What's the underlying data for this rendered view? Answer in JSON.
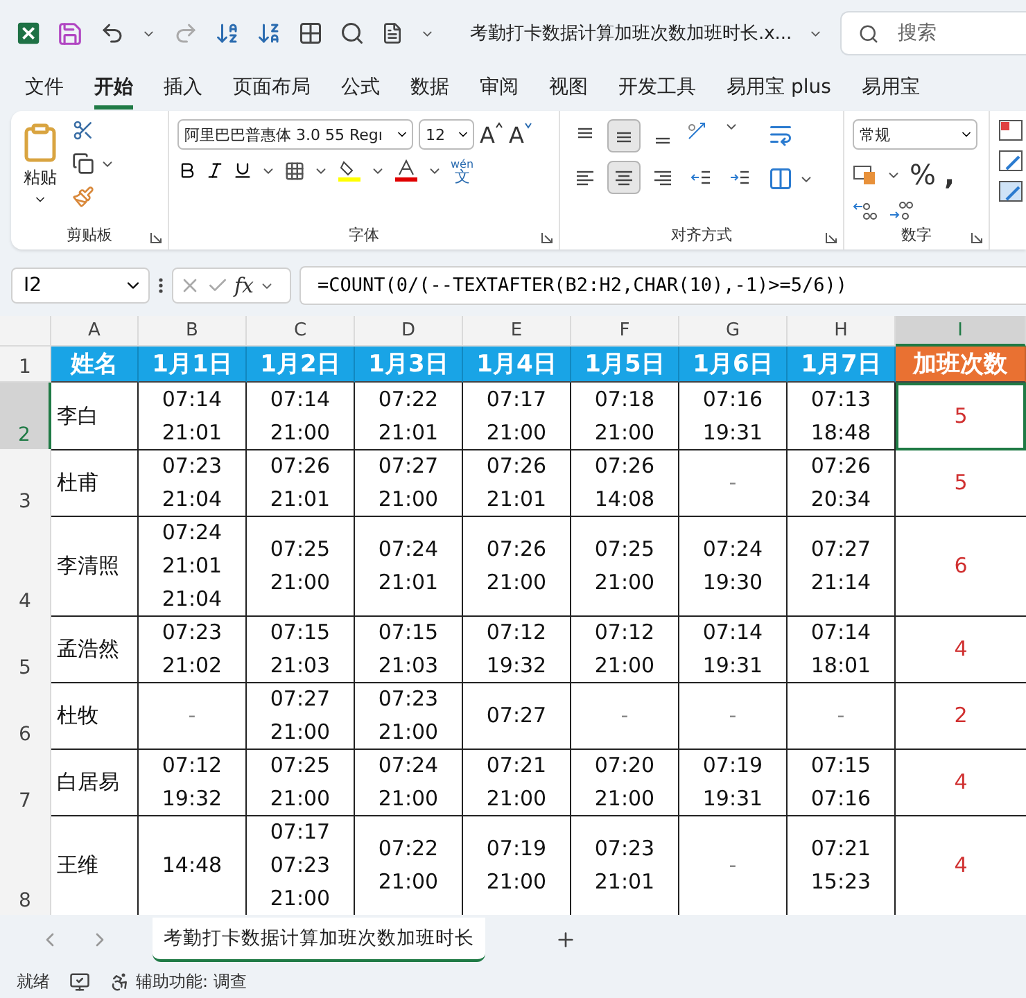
{
  "title_bar": {
    "document_title": "考勤打卡数据计算加班次数加班时长.x...",
    "search": {
      "placeholder": "搜索"
    }
  },
  "menu_tabs": [
    {
      "label": "文件",
      "selected": false
    },
    {
      "label": "开始",
      "selected": true
    },
    {
      "label": "插入",
      "selected": false
    },
    {
      "label": "页面布局",
      "selected": false
    },
    {
      "label": "公式",
      "selected": false
    },
    {
      "label": "数据",
      "selected": false
    },
    {
      "label": "审阅",
      "selected": false
    },
    {
      "label": "视图",
      "selected": false
    },
    {
      "label": "开发工具",
      "selected": false
    },
    {
      "label": "易用宝 plus",
      "selected": false
    },
    {
      "label": "易用宝",
      "selected": false
    }
  ],
  "ribbon": {
    "clipboard": {
      "paste_label": "粘贴",
      "group_label": "剪贴板"
    },
    "font": {
      "font_name": "阿里巴巴普惠体 3.0 55 Regı",
      "font_size": "12",
      "grow_label": "A",
      "shrink_label": "A",
      "phonetic_top": "wén",
      "phonetic_bottom": "文",
      "group_label": "字体"
    },
    "alignment": {
      "buttons": [
        {
          "kind": "top",
          "pressed": false
        },
        {
          "kind": "middle",
          "pressed": true
        },
        {
          "kind": "bottom",
          "pressed": false
        },
        {
          "kind": "left",
          "pressed": false
        },
        {
          "kind": "center",
          "pressed": true
        },
        {
          "kind": "right",
          "pressed": false
        },
        {
          "kind": "outdent",
          "pressed": false
        },
        {
          "kind": "indent",
          "pressed": false
        }
      ],
      "group_label": "对齐方式"
    },
    "number": {
      "format": "常规",
      "percent": "%",
      "comma": ",",
      "group_label": "数字"
    }
  },
  "formula_bar": {
    "name_box": "I2",
    "insert_function": "fx",
    "formula": "=COUNT(0/(--TEXTAFTER(B2:H2,CHAR(10),-1)>=5/6))"
  },
  "columns": [
    {
      "label": "A",
      "selected": false
    },
    {
      "label": "B",
      "selected": false
    },
    {
      "label": "C",
      "selected": false
    },
    {
      "label": "D",
      "selected": false
    },
    {
      "label": "E",
      "selected": false
    },
    {
      "label": "F",
      "selected": false
    },
    {
      "label": "G",
      "selected": false
    },
    {
      "label": "H",
      "selected": false
    },
    {
      "label": "I",
      "selected": true
    }
  ],
  "header_row": {
    "number": "1",
    "selected": false,
    "name": "姓名",
    "dates": [
      "1月1日",
      "1月2日",
      "1月3日",
      "1月4日",
      "1月5日",
      "1月6日",
      "1月7日"
    ],
    "count": "加班次数"
  },
  "rows": [
    {
      "number": "2",
      "selected": true,
      "name": "李白",
      "days": [
        [
          "07:14",
          "21:01"
        ],
        [
          "07:14",
          "21:00"
        ],
        [
          "07:22",
          "21:01"
        ],
        [
          "07:17",
          "21:00"
        ],
        [
          "07:18",
          "21:00"
        ],
        [
          "07:16",
          "19:31"
        ],
        [
          "07:13",
          "18:48"
        ]
      ],
      "count": "5"
    },
    {
      "number": "3",
      "selected": false,
      "name": "杜甫",
      "days": [
        [
          "07:23",
          "21:04"
        ],
        [
          "07:26",
          "21:01"
        ],
        [
          "07:27",
          "21:00"
        ],
        [
          "07:26",
          "21:01"
        ],
        [
          "07:26",
          "14:08"
        ],
        [
          "-"
        ],
        [
          "07:26",
          "20:34"
        ]
      ],
      "count": "5"
    },
    {
      "number": "4",
      "selected": false,
      "name": "李清照",
      "days": [
        [
          "07:24",
          "21:01",
          "21:04"
        ],
        [
          "07:25",
          "21:00"
        ],
        [
          "07:24",
          "21:01"
        ],
        [
          "07:26",
          "21:00"
        ],
        [
          "07:25",
          "21:00"
        ],
        [
          "07:24",
          "19:30"
        ],
        [
          "07:27",
          "21:14"
        ]
      ],
      "count": "6"
    },
    {
      "number": "5",
      "selected": false,
      "name": "孟浩然",
      "days": [
        [
          "07:23",
          "21:02"
        ],
        [
          "07:15",
          "21:03"
        ],
        [
          "07:15",
          "21:03"
        ],
        [
          "07:12",
          "19:32"
        ],
        [
          "07:12",
          "21:00"
        ],
        [
          "07:14",
          "19:31"
        ],
        [
          "07:14",
          "18:01"
        ]
      ],
      "count": "4"
    },
    {
      "number": "6",
      "selected": false,
      "name": "杜牧",
      "days": [
        [
          "-"
        ],
        [
          "07:27",
          "21:00"
        ],
        [
          "07:23",
          "21:00"
        ],
        [
          "07:27"
        ],
        [
          "-"
        ],
        [
          "-"
        ],
        [
          "-"
        ]
      ],
      "count": "2"
    },
    {
      "number": "7",
      "selected": false,
      "name": "白居易",
      "days": [
        [
          "07:12",
          "19:32"
        ],
        [
          "07:25",
          "21:00"
        ],
        [
          "07:24",
          "21:00"
        ],
        [
          "07:21",
          "21:00"
        ],
        [
          "07:20",
          "21:00"
        ],
        [
          "07:19",
          "19:31"
        ],
        [
          "07:15",
          "07:16"
        ]
      ],
      "count": "4"
    },
    {
      "number": "8",
      "selected": false,
      "name": "王维",
      "days": [
        [
          "14:48"
        ],
        [
          "07:17",
          "07:23",
          "21:00"
        ],
        [
          "07:22",
          "21:00"
        ],
        [
          "07:19",
          "21:00"
        ],
        [
          "07:23",
          "21:01"
        ],
        [
          "-"
        ],
        [
          "07:21",
          "15:23"
        ]
      ],
      "count": "4"
    }
  ],
  "sheet_tabs": [
    {
      "label": "考勤打卡数据计算加班次数加班时长",
      "selected": true
    }
  ],
  "status_bar": {
    "ready": "就绪",
    "accessibility": "辅助功能: 调查"
  }
}
